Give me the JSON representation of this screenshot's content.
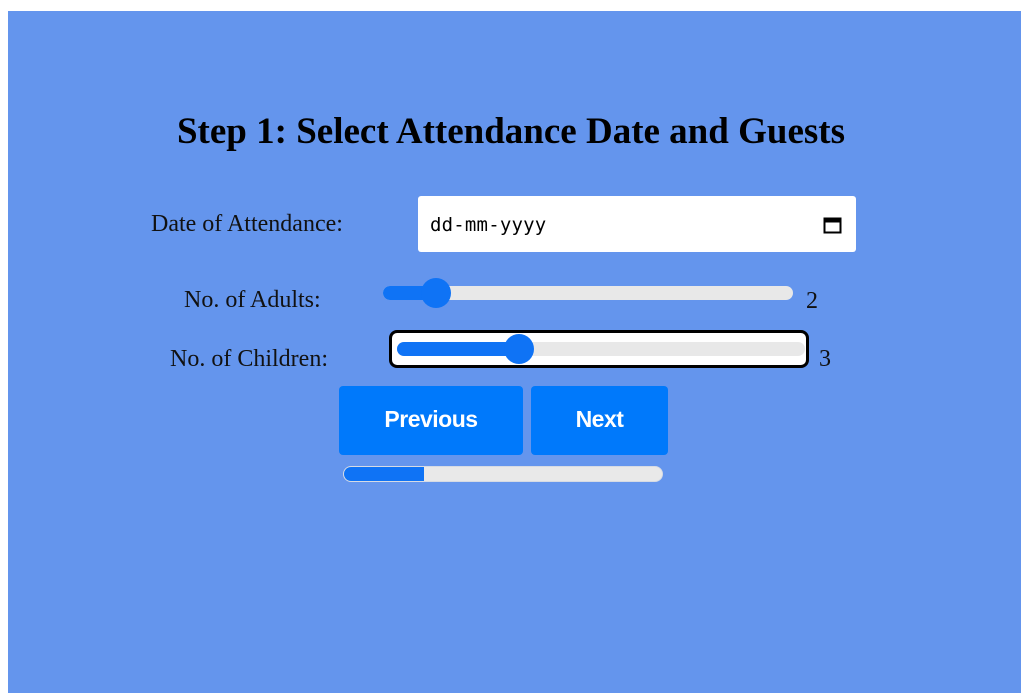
{
  "page": {
    "title": "Step 1: Select Attendance Date and Guests"
  },
  "form": {
    "date": {
      "label": "Date of Attendance:",
      "placeholder": "dd-mm-yyyy",
      "icon": "calendar-icon"
    },
    "adults": {
      "label": "No. of Adults:",
      "value": "2",
      "fraction": 0.13
    },
    "children": {
      "label": "No. of Children:",
      "value": "3",
      "fraction": 0.3
    }
  },
  "buttons": {
    "previous": "Previous",
    "next": "Next"
  },
  "progress": {
    "fraction": 0.25
  },
  "colors": {
    "background": "#6495ED",
    "accent": "#0079fb"
  }
}
